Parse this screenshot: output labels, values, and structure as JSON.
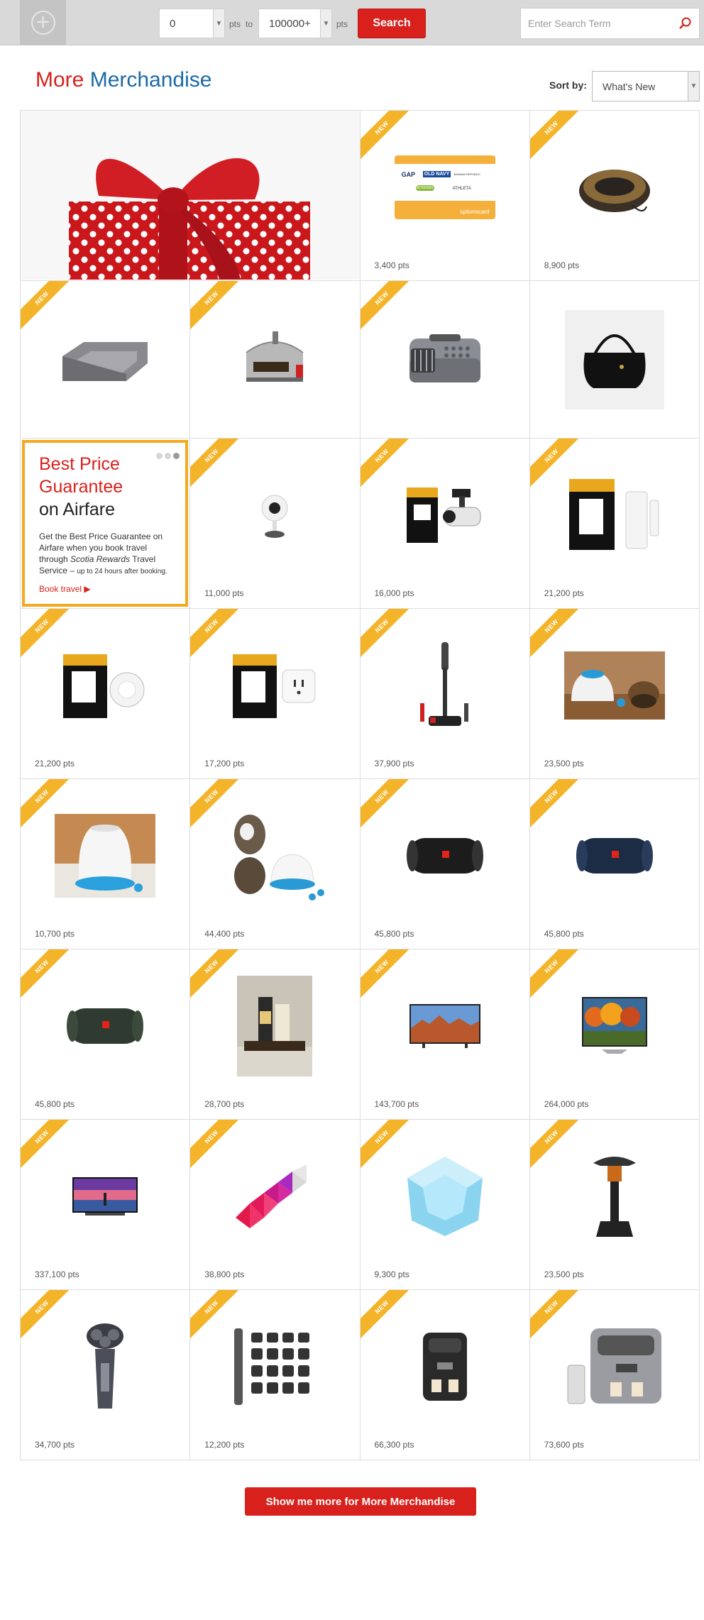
{
  "filter": {
    "min_value": "0",
    "max_value": "100000+",
    "pts_label": "pts",
    "to_label": "to",
    "search_button": "Search",
    "search_placeholder": "Enter Search Term"
  },
  "heading": {
    "part1": "More",
    "part2": "Merchandise"
  },
  "sort": {
    "label": "Sort by:",
    "value": "What's New"
  },
  "badge": "NEW",
  "promo": {
    "title_line1": "Best Price",
    "title_line2": "Guarantee",
    "title_line3": "on Airfare",
    "body_part1": "Get the Best Price Guarantee on Airfare when you book travel through ",
    "body_brand": "Scotia Rewards",
    "body_part2": " Travel Service – ",
    "body_small": "up to 24 hours after booking.",
    "link": "Book travel"
  },
  "gift_card": {
    "brands": [
      "GAP",
      "OLD NAVY",
      "BANANA REPUBLIC",
      "ATHLETA",
      "INTERMIX"
    ],
    "footer": "optionscard"
  },
  "products": [
    {
      "name": "options-gift-card",
      "points": "3,400 pts",
      "badge": true
    },
    {
      "name": "pet-bed-round",
      "points": "8,900 pts",
      "badge": true
    },
    {
      "name": "pet-sofa-bed",
      "points": "",
      "badge": true
    },
    {
      "name": "pizza-oven",
      "points": "",
      "badge": true
    },
    {
      "name": "pet-carrier",
      "points": "",
      "badge": true
    },
    {
      "name": "black-handbag",
      "points": "",
      "badge": false
    },
    {
      "name": "smart-camera-white",
      "points": "11,000 pts",
      "badge": true
    },
    {
      "name": "energizer-outdoor-camera",
      "points": "16,000 pts",
      "badge": true
    },
    {
      "name": "energizer-door-sensor",
      "points": "21,200 pts",
      "badge": true
    },
    {
      "name": "energizer-motion-sensor",
      "points": "21,200 pts",
      "badge": true
    },
    {
      "name": "energizer-smart-plug",
      "points": "17,200 pts",
      "badge": true
    },
    {
      "name": "stick-vacuum",
      "points": "37,900 pts",
      "badge": true
    },
    {
      "name": "pet-treat-toy-dog",
      "points": "23,500 pts",
      "badge": true
    },
    {
      "name": "pet-treat-dispenser",
      "points": "10,700 pts",
      "badge": true
    },
    {
      "name": "ball-launcher-dogs",
      "points": "44,400 pts",
      "badge": true
    },
    {
      "name": "jbl-xtreme-black",
      "points": "45,800 pts",
      "badge": true
    },
    {
      "name": "jbl-xtreme-blue",
      "points": "45,800 pts",
      "badge": true
    },
    {
      "name": "jbl-xtreme-green",
      "points": "45,800 pts",
      "badge": true
    },
    {
      "name": "grooming-set",
      "points": "28,700 pts",
      "badge": true
    },
    {
      "name": "tv-lg-landscape",
      "points": "143,700 pts",
      "badge": true
    },
    {
      "name": "tv-samsung-autumn",
      "points": "264,000 pts",
      "badge": true
    },
    {
      "name": "tv-oled-sunset",
      "points": "337,100 pts",
      "badge": true
    },
    {
      "name": "nanoleaf-triangles",
      "points": "38,800 pts",
      "badge": true
    },
    {
      "name": "smart-light-dodecahedron",
      "points": "9,300 pts",
      "badge": true
    },
    {
      "name": "patio-heater",
      "points": "23,500 pts",
      "badge": true
    },
    {
      "name": "electric-shaver",
      "points": "34,700 pts",
      "badge": true
    },
    {
      "name": "beard-trimmer-kit",
      "points": "12,200 pts",
      "badge": true
    },
    {
      "name": "espresso-machine-black",
      "points": "66,300 pts",
      "badge": true
    },
    {
      "name": "espresso-machine-silver",
      "points": "73,600 pts",
      "badge": true
    }
  ],
  "more_button": "Show me more for More Merchandise",
  "colors": {
    "brand_red": "#d8211c",
    "brand_blue": "#1b6aa5",
    "badge_yellow": "#f4b42a"
  }
}
